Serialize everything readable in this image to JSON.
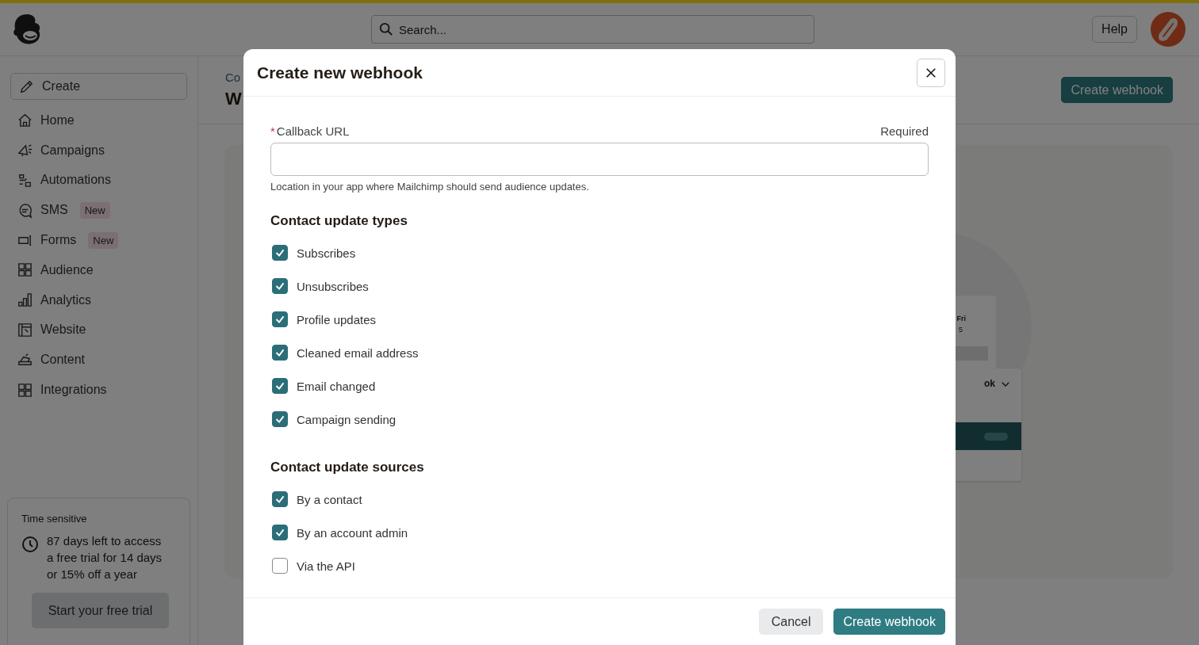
{
  "top_bar": {
    "search": {
      "placeholder": "Search..."
    },
    "help_button": "Help"
  },
  "sidebar": {
    "create_button": "Create",
    "items": [
      {
        "label": "Home"
      },
      {
        "label": "Campaigns"
      },
      {
        "label": "Automations"
      },
      {
        "label": "SMS",
        "badge": "New"
      },
      {
        "label": "Forms",
        "badge": "New"
      },
      {
        "label": "Audience"
      },
      {
        "label": "Analytics"
      },
      {
        "label": "Website"
      },
      {
        "label": "Content"
      },
      {
        "label": "Integrations"
      }
    ],
    "promo": {
      "heading": "Time sensitive",
      "text": "87 days left to access a free trial for 14 days or 15% off a year",
      "button": "Start your free trial"
    }
  },
  "page": {
    "breadcrumb": "Co",
    "title": "W",
    "create_button": "Create webhook",
    "illustration": {
      "day": "Fri",
      "date": "5",
      "label": "ok"
    }
  },
  "modal": {
    "title": "Create new webhook",
    "field": {
      "required_mark": "*",
      "label": "Callback URL",
      "required_note": "Required",
      "hint": "Location in your app where Mailchimp should send audience updates."
    },
    "sections": [
      {
        "heading": "Contact update types",
        "options": [
          {
            "label": "Subscribes",
            "checked": true
          },
          {
            "label": "Unsubscribes",
            "checked": true
          },
          {
            "label": "Profile updates",
            "checked": true
          },
          {
            "label": "Cleaned email address",
            "checked": true
          },
          {
            "label": "Email changed",
            "checked": true
          },
          {
            "label": "Campaign sending",
            "checked": true
          }
        ]
      },
      {
        "heading": "Contact update sources",
        "options": [
          {
            "label": "By a contact",
            "checked": true
          },
          {
            "label": "By an account admin",
            "checked": true
          },
          {
            "label": "Via the API",
            "checked": false
          }
        ]
      }
    ],
    "buttons": {
      "cancel": "Cancel",
      "submit": "Create webhook"
    }
  }
}
